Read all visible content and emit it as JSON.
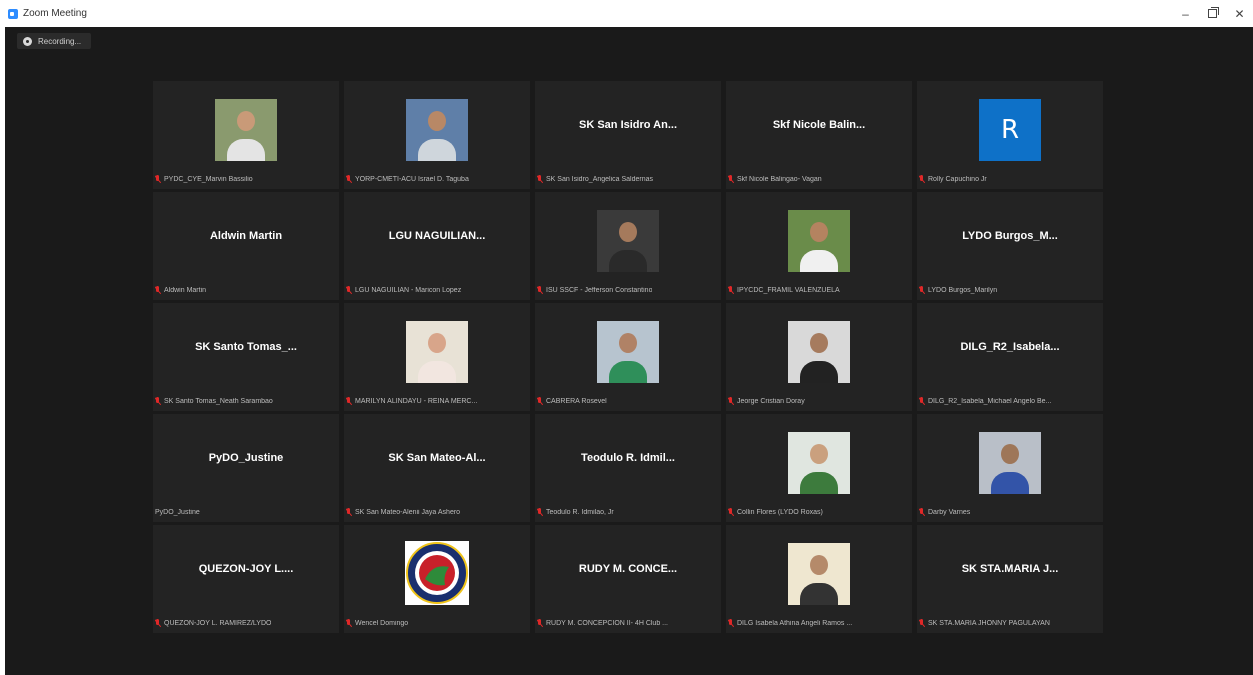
{
  "window": {
    "title": "Zoom Meeting",
    "controls": {
      "minimize": "–",
      "close": "✕"
    }
  },
  "recording": {
    "label": "Recording..."
  },
  "colors": {
    "muted_red": "#e02828",
    "tile_bg": "#232323",
    "meeting_bg": "#1a1a1a"
  },
  "tiles": [
    {
      "display": "",
      "name": "PYDC_CYE_Marvin Bassilio",
      "muted": true,
      "kind": "photo"
    },
    {
      "display": "",
      "name": "YORP-CMETI-ACU Israel D. Taguba",
      "muted": true,
      "kind": "photo"
    },
    {
      "display": "SK San Isidro An...",
      "name": "SK San Isidro_Angelica Saldernas",
      "muted": true,
      "kind": "text"
    },
    {
      "display": "Skf Nicole Balin...",
      "name": "Skf Nicole Balingao- Vagan",
      "muted": true,
      "kind": "text"
    },
    {
      "display": "R",
      "name": "Rolly Capuchino Jr",
      "muted": true,
      "kind": "avatar"
    },
    {
      "display": "Aldwin Martin",
      "name": "Aldwin Martin",
      "muted": true,
      "kind": "text"
    },
    {
      "display": "LGU NAGUILIAN...",
      "name": "LGU NAGUILIAN - Maricon Lopez",
      "muted": true,
      "kind": "text"
    },
    {
      "display": "",
      "name": "ISU SSCF - Jefferson Constantino",
      "muted": true,
      "kind": "photo"
    },
    {
      "display": "",
      "name": "IPYCDC_FRAMIL VALENZUELA",
      "muted": true,
      "kind": "photo"
    },
    {
      "display": "LYDO Burgos_M...",
      "name": "LYDO Burgos_Marilyn",
      "muted": true,
      "kind": "text"
    },
    {
      "display": "SK Santo Tomas_...",
      "name": "SK Santo Tomas_Neath Sarambao",
      "muted": true,
      "kind": "text"
    },
    {
      "display": "",
      "name": "MARILYN ALINDAYU - REINA MERC...",
      "muted": true,
      "kind": "photo"
    },
    {
      "display": "",
      "name": "CABRERA Rosevel",
      "muted": true,
      "kind": "photo"
    },
    {
      "display": "",
      "name": "Jeorge Cristian Doray",
      "muted": true,
      "kind": "photo"
    },
    {
      "display": "DILG_R2_Isabela...",
      "name": "DILG_R2_Isabela_Michael Angelo Be...",
      "muted": true,
      "kind": "text"
    },
    {
      "display": "PyDO_Justine",
      "name": "PyDO_Justine",
      "muted": false,
      "kind": "text"
    },
    {
      "display": "SK San Mateo-Al...",
      "name": "SK San Mateo-Alenii Jaya Ashero",
      "muted": true,
      "kind": "text"
    },
    {
      "display": "Teodulo R. Idmil...",
      "name": "Teodulo R. Idmilao, Jr",
      "muted": true,
      "kind": "text"
    },
    {
      "display": "",
      "name": "Collin Flores (LYDO Roxas)",
      "muted": true,
      "kind": "photo"
    },
    {
      "display": "",
      "name": "Darby Varnes",
      "muted": true,
      "kind": "photo"
    },
    {
      "display": "QUEZON-JOY L....",
      "name": "QUEZON-JOY L. RAMIREZ/LYDO",
      "muted": true,
      "kind": "text"
    },
    {
      "display": "",
      "name": "Wencel Domingo",
      "muted": true,
      "kind": "seal"
    },
    {
      "display": "RUDY M. CONCE...",
      "name": "RUDY M. CONCEPCION II- 4H Club ...",
      "muted": true,
      "kind": "text"
    },
    {
      "display": "",
      "name": "DILG Isabela Athina Angeli Ramos ...",
      "muted": true,
      "kind": "photo"
    },
    {
      "display": "SK STA.MARIA J...",
      "name": "SK STA.MARIA JHONNY PAGULAYAN",
      "muted": true,
      "kind": "text"
    }
  ]
}
